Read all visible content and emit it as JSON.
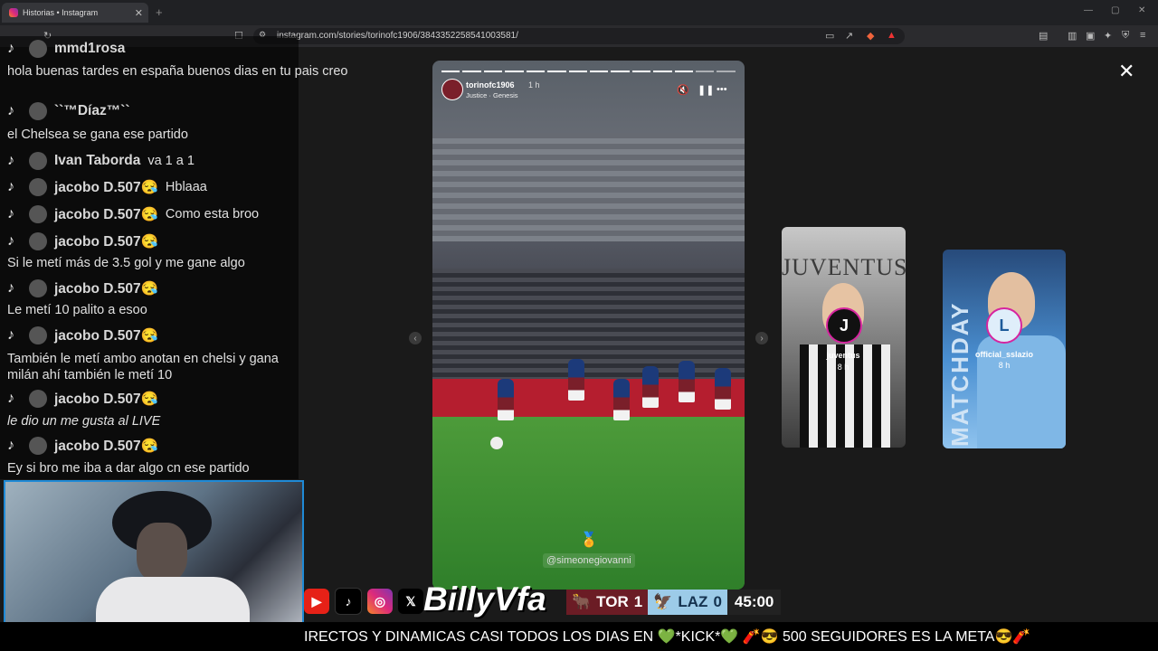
{
  "browser": {
    "tab_title": "Historias • Instagram",
    "url": "instagram.com/stories/torinofc1906/3843352258541003581/",
    "new_tab_icon": "+",
    "window_controls": [
      "—",
      "▢",
      "✕"
    ]
  },
  "story": {
    "username": "torinofc1906",
    "time": "1 h",
    "music": "Justice · Genesis",
    "mention": "@simeonegiovanni",
    "progress_segments": 14,
    "progress_done": 12
  },
  "next_stories": [
    {
      "name": "juventus",
      "time": "8 h",
      "avatar_letter": "J",
      "title": "JUVENTUS"
    },
    {
      "name": "official_sslazio",
      "time": "8 h",
      "avatar_letter": "L",
      "vertical_text": "MATCHDAY"
    }
  ],
  "chat": {
    "rows": [
      {
        "name": "mmd1rosa",
        "message": ""
      },
      {
        "name": "``™Díaz™``",
        "message": ""
      },
      {
        "name": "Ivan Taborda",
        "message": "va 1 a 1"
      },
      {
        "name": "jacobo D.507😪",
        "message": "Hblaaa"
      },
      {
        "name": "jacobo D.507😪",
        "message": "Como esta broo"
      },
      {
        "name": "jacobo D.507😪",
        "message": ""
      },
      {
        "name": "jacobo D.507😪",
        "message": ""
      },
      {
        "name": "jacobo D.507😪",
        "message": ""
      },
      {
        "name": "jacobo D.507😪",
        "message": ""
      },
      {
        "name": "jacobo D.507😪",
        "message": ""
      }
    ],
    "lines": [
      "hola buenas tardes en españa buenos dias en tu pais creo",
      "el Chelsea se gana ese partido",
      "Si le metí más de 3.5 gol y me gane algo",
      "Le metí 10 palito a esoo",
      "También le metí ambo anotan en chelsi y gana milán ahí también le metí 10",
      "le dio un me gusta al LIVE",
      "Ey si bro me iba a dar algo cn ese partido"
    ]
  },
  "overlay": {
    "brand": "BillyVfa",
    "score": {
      "home": "TOR",
      "home_goals": "1",
      "away": "LAZ",
      "away_goals": "0",
      "clock": "45:00"
    },
    "ticker": "IRECTOS Y DINAMICAS CASI TODOS LOS DIAS EN 💚*KICK*💚     🧨😎 500 SEGUIDORES ES LA META😎🧨"
  },
  "colors": {
    "accent": "#1f8ad6",
    "torino": "#6b1c25",
    "lazio": "#9ccbe8"
  }
}
